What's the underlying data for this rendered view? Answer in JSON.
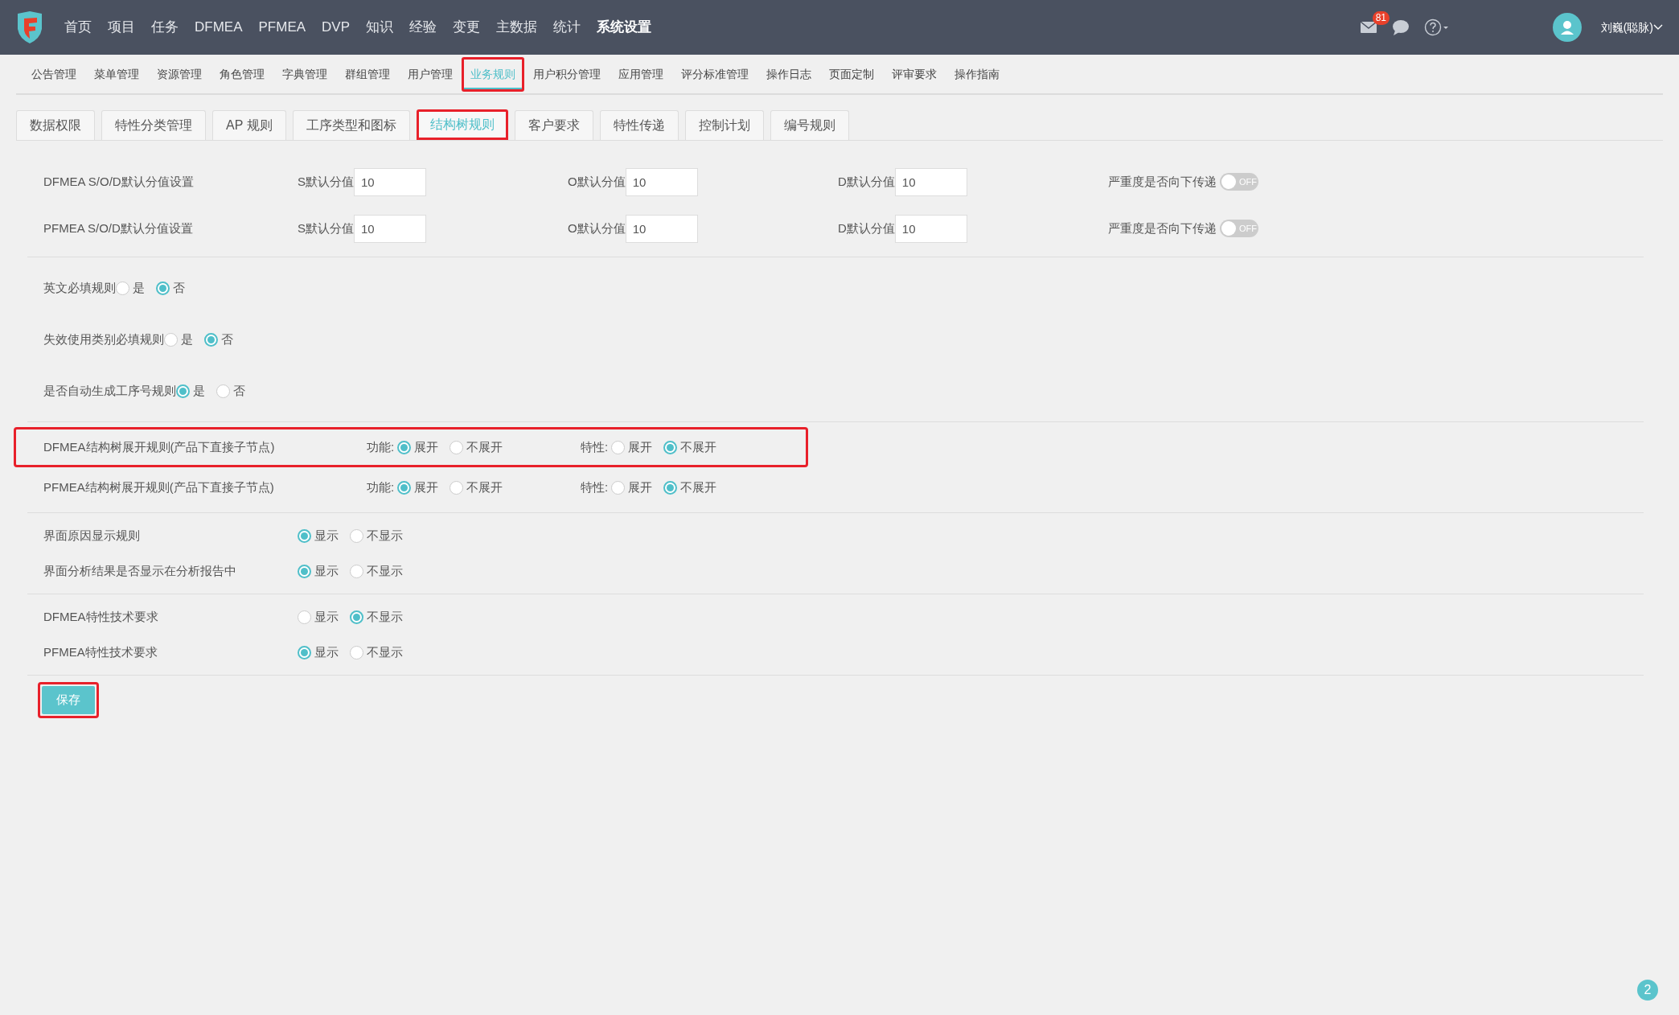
{
  "topbar": {
    "menu": [
      {
        "label": "首页",
        "selected": false
      },
      {
        "label": "项目",
        "selected": false
      },
      {
        "label": "任务",
        "selected": false
      },
      {
        "label": "DFMEA",
        "selected": false
      },
      {
        "label": "PFMEA",
        "selected": false
      },
      {
        "label": "DVP",
        "selected": false
      },
      {
        "label": "知识",
        "selected": false
      },
      {
        "label": "经验",
        "selected": false
      },
      {
        "label": "变更",
        "selected": false
      },
      {
        "label": "主数据",
        "selected": false
      },
      {
        "label": "统计",
        "selected": false
      },
      {
        "label": "系统设置",
        "selected": true
      }
    ],
    "mail_count": "81",
    "user": "刘巍(聪脉)"
  },
  "subnav": [
    {
      "label": "公告管理",
      "selected": false,
      "highlighted": false
    },
    {
      "label": "菜单管理",
      "selected": false,
      "highlighted": false
    },
    {
      "label": "资源管理",
      "selected": false,
      "highlighted": false
    },
    {
      "label": "角色管理",
      "selected": false,
      "highlighted": false
    },
    {
      "label": "字典管理",
      "selected": false,
      "highlighted": false
    },
    {
      "label": "群组管理",
      "selected": false,
      "highlighted": false
    },
    {
      "label": "用户管理",
      "selected": false,
      "highlighted": false
    },
    {
      "label": "业务规则",
      "selected": true,
      "highlighted": true
    },
    {
      "label": "用户积分管理",
      "selected": false,
      "highlighted": false
    },
    {
      "label": "应用管理",
      "selected": false,
      "highlighted": false
    },
    {
      "label": "评分标准管理",
      "selected": false,
      "highlighted": false
    },
    {
      "label": "操作日志",
      "selected": false,
      "highlighted": false
    },
    {
      "label": "页面定制",
      "selected": false,
      "highlighted": false
    },
    {
      "label": "评审要求",
      "selected": false,
      "highlighted": false
    },
    {
      "label": "操作指南",
      "selected": false,
      "highlighted": false
    }
  ],
  "tabs": [
    {
      "label": "数据权限",
      "selected": false,
      "highlighted": false
    },
    {
      "label": "特性分类管理",
      "selected": false,
      "highlighted": false
    },
    {
      "label": "AP 规则",
      "selected": false,
      "highlighted": false
    },
    {
      "label": "工序类型和图标",
      "selected": false,
      "highlighted": false
    },
    {
      "label": "结构树规则",
      "selected": true,
      "highlighted": true
    },
    {
      "label": "客户要求",
      "selected": false,
      "highlighted": false
    },
    {
      "label": "特性传递",
      "selected": false,
      "highlighted": false
    },
    {
      "label": "控制计划",
      "selected": false,
      "highlighted": false
    },
    {
      "label": "编号规则",
      "selected": false,
      "highlighted": false
    }
  ],
  "sections": [
    {
      "rows": [
        {
          "kind": "scores",
          "label": "DFMEA S/O/D默认分值设置",
          "fields": [
            {
              "label": "S默认分值",
              "value": "10"
            },
            {
              "label": "O默认分值",
              "value": "10"
            },
            {
              "label": "D默认分值",
              "value": "10"
            }
          ],
          "toggle": {
            "label": "严重度是否向下传递",
            "on": false,
            "text": "OFF"
          }
        },
        {
          "kind": "scores",
          "label": "PFMEA S/O/D默认分值设置",
          "fields": [
            {
              "label": "S默认分值",
              "value": "10"
            },
            {
              "label": "O默认分值",
              "value": "10"
            },
            {
              "label": "D默认分值",
              "value": "10"
            }
          ],
          "toggle": {
            "label": "严重度是否向下传递",
            "on": false,
            "text": "OFF"
          }
        }
      ]
    },
    {
      "rows": [
        {
          "kind": "inline",
          "label": "英文必填规则",
          "options": [
            {
              "label": "是",
              "selected": false
            },
            {
              "label": "否",
              "selected": true
            }
          ]
        },
        {
          "kind": "inline",
          "label": "失效使用类别必填规则",
          "options": [
            {
              "label": "是",
              "selected": false
            },
            {
              "label": "否",
              "selected": true
            }
          ]
        },
        {
          "kind": "inline",
          "label": "是否自动生成工序号规则",
          "options": [
            {
              "label": "是",
              "selected": true
            },
            {
              "label": "否",
              "selected": false
            }
          ]
        }
      ]
    },
    {
      "rows": [
        {
          "kind": "tree",
          "label": "DFMEA结构树展开规则(产品下直接子节点)",
          "highlighted": true,
          "groups": [
            {
              "label": "功能:",
              "options": [
                {
                  "label": "展开",
                  "selected": true
                },
                {
                  "label": "不展开",
                  "selected": false
                }
              ]
            },
            {
              "label": "特性:",
              "options": [
                {
                  "label": "展开",
                  "selected": false
                },
                {
                  "label": "不展开",
                  "selected": true
                }
              ]
            }
          ]
        },
        {
          "kind": "tree",
          "label": "PFMEA结构树展开规则(产品下直接子节点)",
          "highlighted": false,
          "groups": [
            {
              "label": "功能:",
              "options": [
                {
                  "label": "展开",
                  "selected": true
                },
                {
                  "label": "不展开",
                  "selected": false
                }
              ]
            },
            {
              "label": "特性:",
              "options": [
                {
                  "label": "展开",
                  "selected": false
                },
                {
                  "label": "不展开",
                  "selected": true
                }
              ]
            }
          ]
        }
      ]
    },
    {
      "rows": [
        {
          "kind": "radio",
          "label": "界面原因显示规则",
          "options": [
            {
              "label": "显示",
              "selected": true
            },
            {
              "label": "不显示",
              "selected": false
            }
          ]
        },
        {
          "kind": "radio",
          "label": "界面分析结果是否显示在分析报告中",
          "options": [
            {
              "label": "显示",
              "selected": true
            },
            {
              "label": "不显示",
              "selected": false
            }
          ]
        }
      ]
    },
    {
      "rows": [
        {
          "kind": "radio",
          "label": "DFMEA特性技术要求",
          "options": [
            {
              "label": "显示",
              "selected": false
            },
            {
              "label": "不显示",
              "selected": true
            }
          ]
        },
        {
          "kind": "radio",
          "label": "PFMEA特性技术要求",
          "options": [
            {
              "label": "显示",
              "selected": true
            },
            {
              "label": "不显示",
              "selected": false
            }
          ]
        }
      ]
    }
  ],
  "save_button": {
    "label": "保存",
    "highlighted": true
  },
  "corner_badge": "2"
}
